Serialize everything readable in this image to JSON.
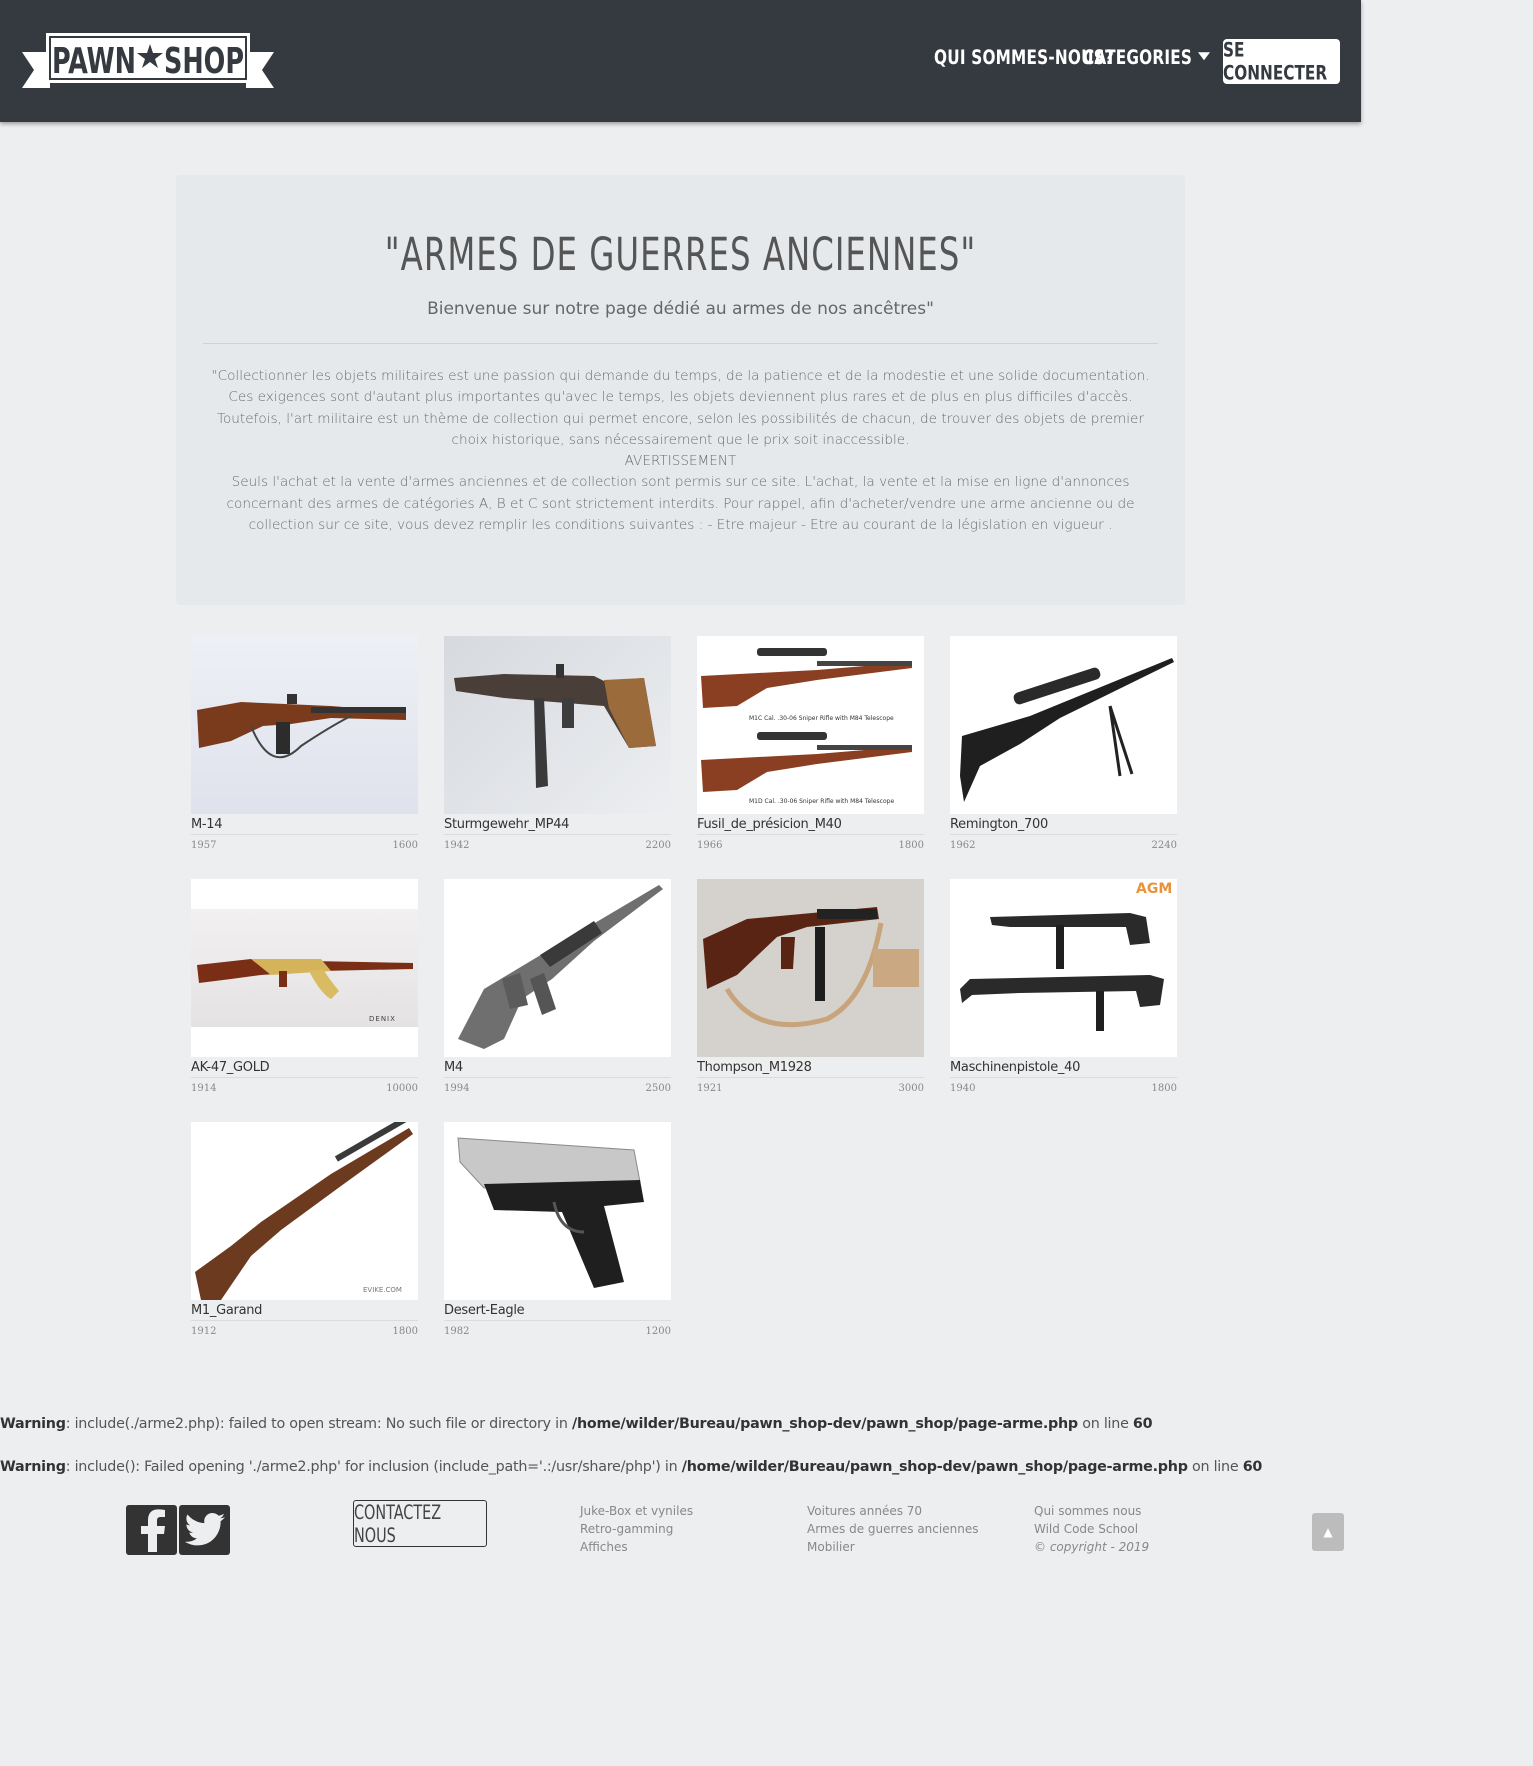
{
  "brand": {
    "logo_left": "PAWN",
    "logo_right": "SHOP"
  },
  "nav": {
    "about": "QUI SOMMES-NOUS?",
    "categories": "CATEGORIES",
    "login": "SE CONNECTER"
  },
  "hero": {
    "title": "\"ARMES DE GUERRES ANCIENNES\"",
    "subtitle": "Bienvenue sur notre page dédié au armes de nos ancêtres\"",
    "intro": "\"Collectionner les objets militaires est une passion qui demande du temps, de la patience et de la modestie et une solide documentation. Ces exigences sont d'autant plus importantes qu'avec le temps, les objets deviennent plus rares et de plus en plus difficiles d'accès. Toutefois, l'art militaire est un thème de collection qui permet encore, selon les possibilités de chacun, de trouver des objets de premier choix historique, sans nécessairement que le prix soit inaccessible.",
    "warning_title": "AVERTISSEMENT",
    "warning_text": "Seuls l'achat et la vente d'armes anciennes et de collection sont permis sur ce site. L'achat, la vente et la mise en ligne d'annonces concernant des armes de catégories A, B et C sont strictement interdits. Pour rappel, afin d'acheter/vendre une arme ancienne ou de collection sur ce site, vous devez remplir les conditions suivantes : - Etre majeur - Etre au courant de la législation en vigueur ."
  },
  "products": [
    {
      "name": "M-14",
      "year": "1957",
      "price": "1600"
    },
    {
      "name": "Sturmgewehr_MP44",
      "year": "1942",
      "price": "2200"
    },
    {
      "name": "Fusil_de_présicion_M40",
      "year": "1966",
      "price": "1800",
      "caption1": "M1C Cal. .30-06 Sniper Rifle with M84 Telescope",
      "caption2": "M1D Cal. .30-06 Sniper Rifle with M84 Telescope"
    },
    {
      "name": "Remington_700",
      "year": "1962",
      "price": "2240"
    },
    {
      "name": "AK-47_GOLD",
      "year": "1914",
      "price": "10000",
      "watermark": "DENIX"
    },
    {
      "name": "M4",
      "year": "1994",
      "price": "2500"
    },
    {
      "name": "Thompson_M1928",
      "year": "1921",
      "price": "3000"
    },
    {
      "name": "Maschinenpistole_40",
      "year": "1940",
      "price": "1800",
      "watermark": "AGM"
    },
    {
      "name": "M1_Garand",
      "year": "1912",
      "price": "1800",
      "watermark": "EVIKE.COM"
    },
    {
      "name": "Desert-Eagle",
      "year": "1982",
      "price": "1200"
    }
  ],
  "warnings": [
    {
      "label": "Warning",
      "msg": ": include(./arme2.php): failed to open stream: No such file or directory in ",
      "path": "/home/wilder/Bureau/pawn_shop-dev/pawn_shop/page-arme.php",
      "on": " on line ",
      "line": "60"
    },
    {
      "label": "Warning",
      "msg": ": include(): Failed opening './arme2.php' for inclusion (include_path='.:/usr/share/php') in ",
      "path": "/home/wilder/Bureau/pawn_shop-dev/pawn_shop/page-arme.php",
      "on": " on line ",
      "line": "60"
    }
  ],
  "footer": {
    "contact": "CONTACTEZ NOUS",
    "col1": [
      "Juke-Box et vyniles",
      "Retro-gamming",
      "Affiches"
    ],
    "col2": [
      "Voitures années 70",
      "Armes de guerres anciennes",
      "Mobilier"
    ],
    "col3": [
      "Qui sommes nous",
      "Wild Code School"
    ],
    "copyright": "© copyright - 2019",
    "to_top": "▲"
  },
  "icons": [
    "facebook-icon",
    "twitter-icon",
    "caret-down-icon",
    "arrow-up-icon"
  ],
  "colors": {
    "header_bg": "#343a40",
    "page_bg": "#edeef0",
    "jumbotron_bg": "#e6e9ec"
  }
}
